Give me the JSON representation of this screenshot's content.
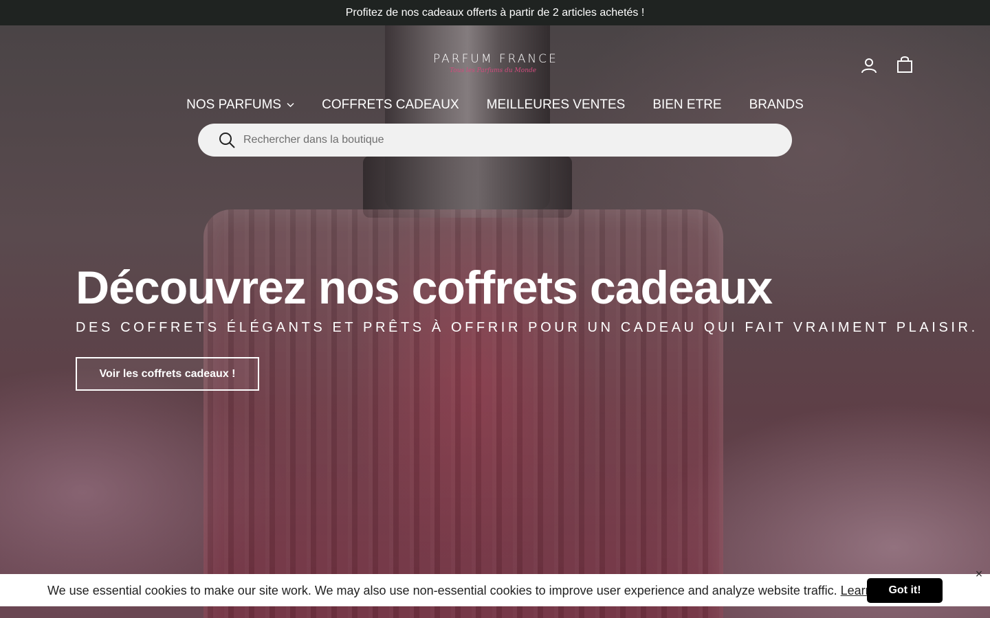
{
  "announcement": "Profitez de nos cadeaux offerts à partir de 2 articles achetés !",
  "header": {
    "logo_text": "PARFUM FRANCE",
    "logo_tagline": "Tous les Parfums du Monde",
    "account_icon": "person-icon",
    "cart_icon": "shopping-bag-icon"
  },
  "nav": {
    "items": [
      {
        "label": "NOS PARFUMS",
        "has_dropdown": true
      },
      {
        "label": "COFFRETS CADEAUX"
      },
      {
        "label": "MEILLEURES VENTES"
      },
      {
        "label": "BIEN ETRE"
      },
      {
        "label": "BRANDS"
      }
    ]
  },
  "search": {
    "placeholder": "Rechercher dans la boutique",
    "value": ""
  },
  "hero": {
    "title": "Découvrez nos coffrets cadeaux",
    "subtitle": "DES COFFRETS ÉLÉGANTS ET PRÊTS À OFFRIR POUR UN CADEAU QUI FAIT VRAIMENT PLAISIR.",
    "cta_label": "Voir les coffrets cadeaux !"
  },
  "cookie_banner": {
    "text": "We use essential cookies to make our site work. We may also use non-essential cookies to improve user experience and analyze website traffic.",
    "link_label": "Learn more",
    "trailing": ".",
    "button_label": "Got it!",
    "close_label": "×"
  },
  "colors": {
    "announcement_bg": "#1f2321",
    "logo_accent": "#d24b7e",
    "search_bg": "#f1f1f1",
    "cookie_button_bg": "#000000"
  }
}
